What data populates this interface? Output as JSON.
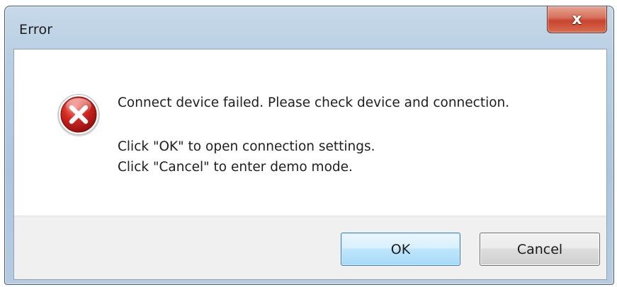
{
  "window": {
    "title": "Error",
    "close_label": "x"
  },
  "message": {
    "icon": "error-icon",
    "line1": "Connect device failed. Please check device and connection.",
    "line2": "Click \"OK\" to open connection settings.",
    "line3": "Click \"Cancel\" to enter demo mode."
  },
  "buttons": {
    "ok_label": "OK",
    "cancel_label": "Cancel"
  },
  "colors": {
    "frame": "#b9cfe3",
    "close_button": "#c7452f",
    "error_icon": "#c41e1e",
    "footer": "#f0f0f0",
    "default_button_border": "#3c7fb1"
  }
}
